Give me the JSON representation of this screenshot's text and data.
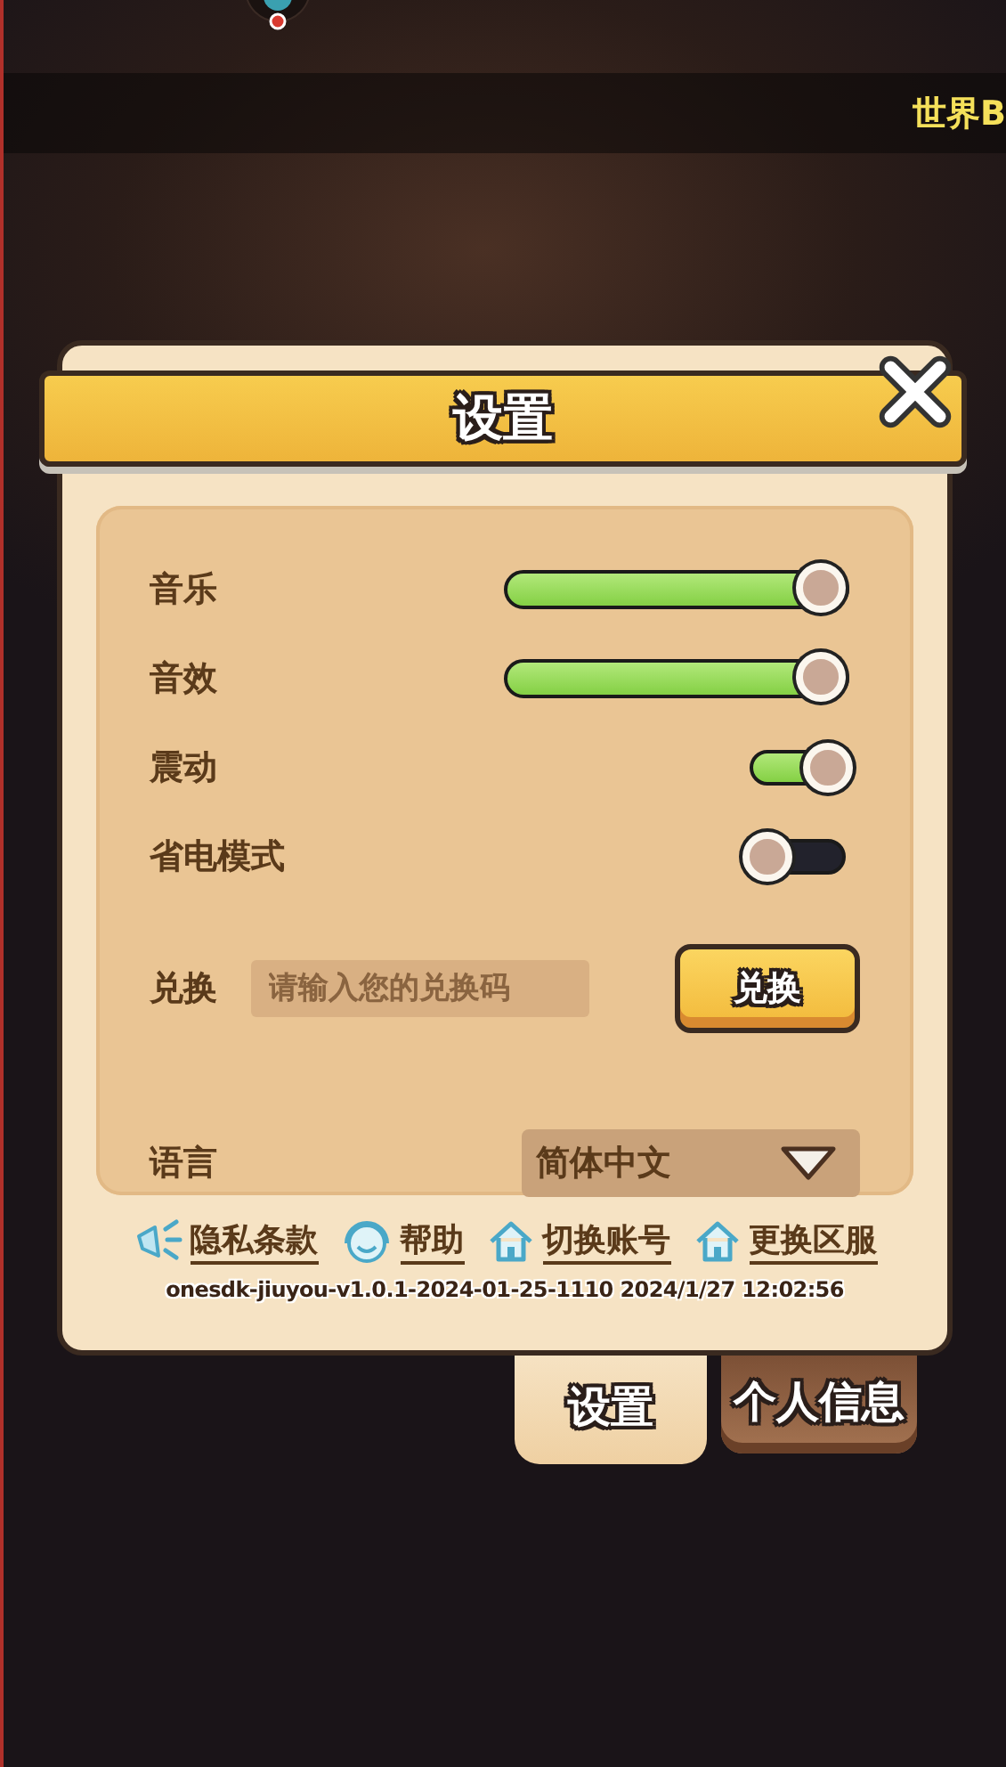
{
  "top_bar": {
    "channel_label": "世界B"
  },
  "dialog": {
    "title": "设置",
    "settings": [
      {
        "kind": "slider",
        "label": "音乐",
        "level": 1
      },
      {
        "kind": "slider",
        "label": "音效",
        "level": 1
      },
      {
        "kind": "toggle",
        "label": "震动",
        "on": true
      },
      {
        "kind": "toggle",
        "label": "省电模式",
        "on": false
      }
    ],
    "redeem": {
      "label": "兑换",
      "placeholder": "请输入您的兑换码",
      "button": "兑换"
    },
    "language": {
      "label": "语言",
      "value": "简体中文"
    },
    "links": [
      {
        "kind": "megaphone",
        "label": "隐私条款"
      },
      {
        "kind": "support",
        "label": "帮助"
      },
      {
        "kind": "house",
        "label": "切换账号"
      },
      {
        "kind": "house",
        "label": "更换区服"
      }
    ],
    "version": "onesdk-jiuyou-v1.0.1-2024-01-25-1110 2024/1/27 12:02:56"
  },
  "tabs": [
    {
      "label": "设置",
      "selected": true
    },
    {
      "label": "个人信息",
      "selected": false
    }
  ]
}
